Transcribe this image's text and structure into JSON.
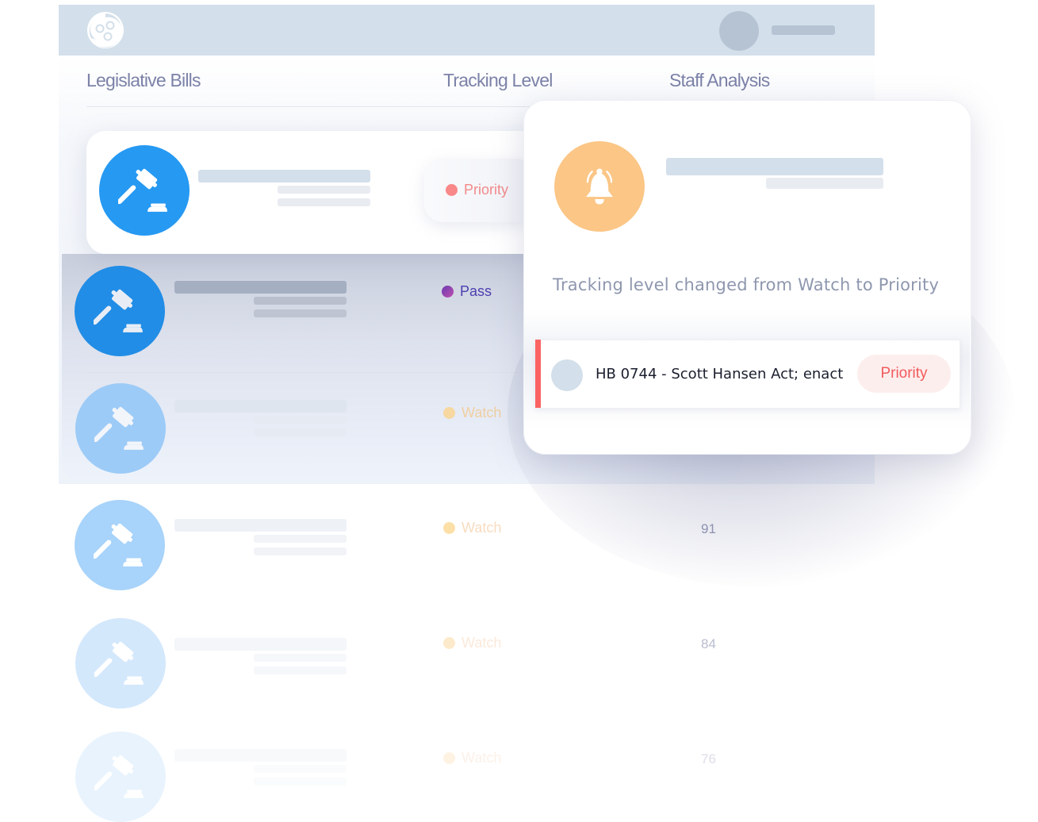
{
  "header": {
    "logo_icon": "app-logo-icon",
    "avatar_icon": "user-avatar-placeholder"
  },
  "table": {
    "columns": [
      "Legislative Bills",
      "Tracking Level",
      "Staff Analysis"
    ],
    "rows": [
      {
        "icon": "gavel-icon",
        "tracking": "Priority",
        "score": null,
        "circle_color": "#2699f2",
        "dot_color": "#f98888",
        "text_color": "#f28a8a",
        "opacity": 1
      },
      {
        "icon": "gavel-icon",
        "tracking": "Pass",
        "score": null,
        "circle_color": "#218de6",
        "dot_color": "#8c46c0",
        "text_color": "#4a3fb0",
        "opacity": 1
      },
      {
        "icon": "gavel-icon",
        "tracking": "Watch",
        "score": null,
        "circle_color": "#9dcbf7",
        "dot_color": "#f6d8a0",
        "text_color": "#f0cfa2",
        "opacity": 1
      },
      {
        "icon": "gavel-icon",
        "tracking": "Watch",
        "score": "91",
        "circle_color": "#a8d3fa",
        "dot_color": "#fce0a8",
        "text_color": "#f8dcc0",
        "opacity": 1
      },
      {
        "icon": "gavel-icon",
        "tracking": "Watch",
        "score": "84",
        "circle_color": "#d4e8fc",
        "dot_color": "#fdeacb",
        "text_color": "#fbe9da",
        "opacity": 1
      },
      {
        "icon": "gavel-icon",
        "tracking": "Watch",
        "score": "76",
        "circle_color": "#e8f3fd",
        "dot_color": "#fef3e2",
        "text_color": "#fcf1e8",
        "opacity": 1
      }
    ]
  },
  "popup": {
    "icon": "bell-icon",
    "message": "Tracking level changed from Watch to Priority",
    "notification": {
      "title": "HB 0744 - Scott Hansen Act; enact",
      "badge": "Priority",
      "accent_color": "#fb6363"
    }
  }
}
